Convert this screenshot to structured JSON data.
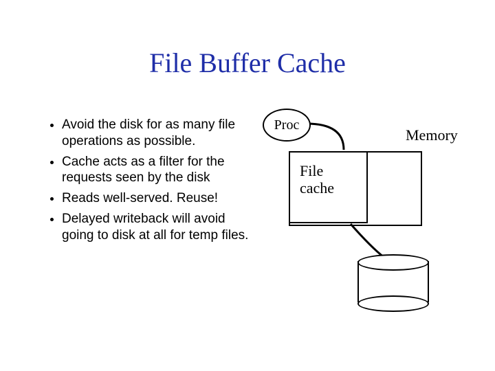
{
  "title": "File Buffer Cache",
  "bullets": [
    "Avoid the disk for as many file operations as possible.",
    "Cache acts as a filter for the requests seen by the disk",
    "Reads well-served.  Reuse!",
    "Delayed writeback will avoid going to disk at all for temp files."
  ],
  "diagram": {
    "proc_label": "Proc",
    "memory_label": "Memory",
    "filecache_label_line1": "File",
    "filecache_label_line2": "cache"
  }
}
